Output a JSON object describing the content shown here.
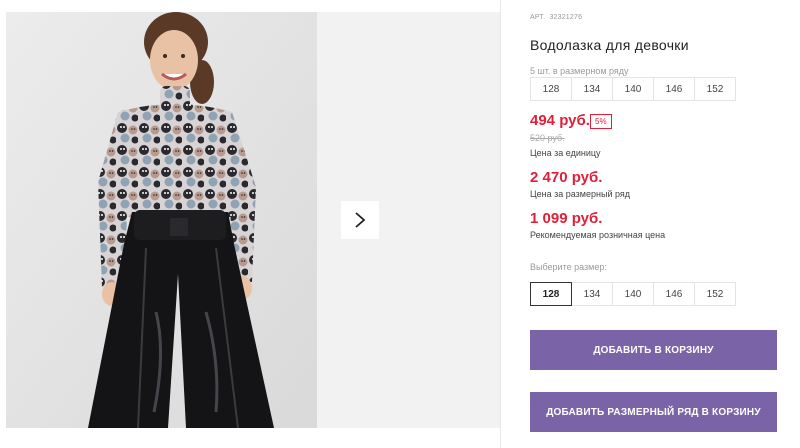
{
  "gallery": {
    "next_icon": "chevron-right-icon"
  },
  "product": {
    "sku_label": "АРТ.",
    "sku": "32321276",
    "title": "Водолазка для девочки"
  },
  "pack": {
    "label": "5 шт. в размерном ряду",
    "sizes": [
      "128",
      "134",
      "140",
      "146",
      "152"
    ]
  },
  "prices": {
    "unit_price": "494 руб.",
    "discount": "5%",
    "old_price": "520 руб.",
    "unit_caption": "Цена за единицу",
    "pack_price": "2 470 руб.",
    "pack_caption": "Цена за размерный ряд",
    "retail_price": "1 099 руб.",
    "retail_caption": "Рекомендуемая розничная цена"
  },
  "size_select": {
    "label": "Выберите размер:",
    "sizes": [
      "128",
      "134",
      "140",
      "146",
      "152"
    ],
    "selected": "128"
  },
  "actions": {
    "add_to_cart": "ДОБАВИТЬ В КОРЗИНУ",
    "add_pack_to_cart": "ДОБАВИТЬ РАЗМЕРНЫЙ РЯД В КОРЗИНУ"
  },
  "colors": {
    "accent": "#7b63a8",
    "price": "#e0203a"
  }
}
